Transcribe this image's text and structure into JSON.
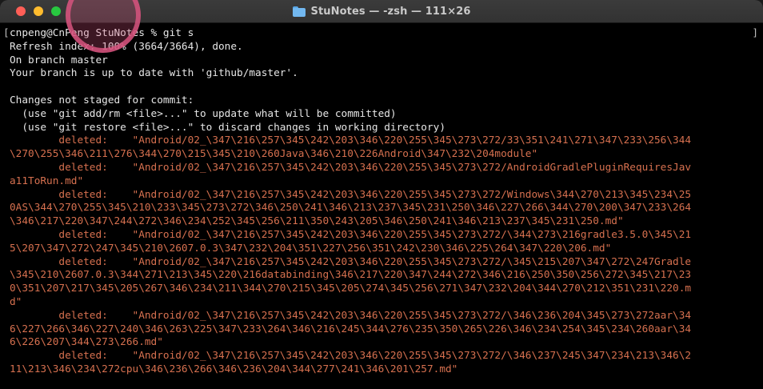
{
  "window": {
    "title": "StuNotes — -zsh — 111×26",
    "folder_icon": "folder-icon",
    "controls": [
      "close",
      "minimize",
      "zoom"
    ]
  },
  "colors": {
    "background": "#000000",
    "text": "#e6e6e6",
    "deleted": "#d6704f",
    "close": "#ff5f57",
    "minimize": "#febc2e",
    "zoom": "#28c840"
  },
  "terminal": {
    "bracket_left": "[",
    "bracket_right": "]",
    "lines": [
      {
        "text": "cnpeng@CnPeng StuNotes % git s",
        "kind": "normal"
      },
      {
        "text": "Refresh index: 100% (3664/3664), done.",
        "kind": "normal"
      },
      {
        "text": "On branch master",
        "kind": "normal"
      },
      {
        "text": "Your branch is up to date with 'github/master'.",
        "kind": "normal"
      },
      {
        "text": "",
        "kind": "normal"
      },
      {
        "text": "Changes not staged for commit:",
        "kind": "normal"
      },
      {
        "text": "  (use \"git add/rm <file>...\" to update what will be committed)",
        "kind": "normal"
      },
      {
        "text": "  (use \"git restore <file>...\" to discard changes in working directory)",
        "kind": "normal"
      },
      {
        "text": "        deleted:    \"Android/02_\\347\\216\\257\\345\\242\\203\\346\\220\\255\\345\\273\\272/33\\351\\241\\271\\347\\233\\256\\344",
        "kind": "deleted"
      },
      {
        "text": "\\270\\255\\346\\211\\276\\344\\270\\215\\345\\210\\260Java\\346\\210\\226Android\\347\\232\\204module\"",
        "kind": "deleted"
      },
      {
        "text": "        deleted:    \"Android/02_\\347\\216\\257\\345\\242\\203\\346\\220\\255\\345\\273\\272/AndroidGradlePluginRequiresJav",
        "kind": "deleted"
      },
      {
        "text": "a11ToRun.md\"",
        "kind": "deleted"
      },
      {
        "text": "        deleted:    \"Android/02_\\347\\216\\257\\345\\242\\203\\346\\220\\255\\345\\273\\272/Windows\\344\\270\\213\\345\\234\\25",
        "kind": "deleted"
      },
      {
        "text": "0AS\\344\\270\\255\\345\\210\\233\\345\\273\\272\\346\\250\\241\\346\\213\\237\\345\\231\\250\\346\\227\\266\\344\\270\\200\\347\\233\\264",
        "kind": "deleted"
      },
      {
        "text": "\\346\\217\\220\\347\\244\\272\\346\\234\\252\\345\\256\\211\\350\\243\\205\\346\\250\\241\\346\\213\\237\\345\\231\\250.md\"",
        "kind": "deleted"
      },
      {
        "text": "        deleted:    \"Android/02_\\347\\216\\257\\345\\242\\203\\346\\220\\255\\345\\273\\272/\\344\\273\\216gradle3.5.0\\345\\21",
        "kind": "deleted"
      },
      {
        "text": "5\\207\\347\\272\\247\\345\\210\\2607.0.3\\347\\232\\204\\351\\227\\256\\351\\242\\230\\346\\225\\264\\347\\220\\206.md\"",
        "kind": "deleted"
      },
      {
        "text": "        deleted:    \"Android/02_\\347\\216\\257\\345\\242\\203\\346\\220\\255\\345\\273\\272/\\345\\215\\207\\347\\272\\247Gradle",
        "kind": "deleted"
      },
      {
        "text": "\\345\\210\\2607.0.3\\344\\271\\213\\345\\220\\216databinding\\346\\217\\220\\347\\244\\272\\346\\216\\250\\350\\256\\272\\345\\217\\23",
        "kind": "deleted"
      },
      {
        "text": "0\\351\\207\\217\\345\\205\\267\\346\\234\\211\\344\\270\\215\\345\\205\\274\\345\\256\\271\\347\\232\\204\\344\\270\\212\\351\\231\\220.m",
        "kind": "deleted"
      },
      {
        "text": "d\"",
        "kind": "deleted"
      },
      {
        "text": "        deleted:    \"Android/02_\\347\\216\\257\\345\\242\\203\\346\\220\\255\\345\\273\\272/\\346\\236\\204\\345\\273\\272aar\\34",
        "kind": "deleted"
      },
      {
        "text": "6\\227\\266\\346\\227\\240\\346\\263\\225\\347\\233\\264\\346\\216\\245\\344\\276\\235\\350\\265\\226\\346\\234\\254\\345\\234\\260aar\\34",
        "kind": "deleted"
      },
      {
        "text": "6\\226\\207\\344\\273\\266.md\"",
        "kind": "deleted"
      },
      {
        "text": "        deleted:    \"Android/02_\\347\\216\\257\\345\\242\\203\\346\\220\\255\\345\\273\\272/\\346\\237\\245\\347\\234\\213\\346\\2",
        "kind": "deleted"
      },
      {
        "text": "11\\213\\346\\234\\272cpu\\346\\236\\266\\346\\236\\204\\344\\277\\241\\346\\201\\257.md\"",
        "kind": "deleted"
      }
    ]
  }
}
